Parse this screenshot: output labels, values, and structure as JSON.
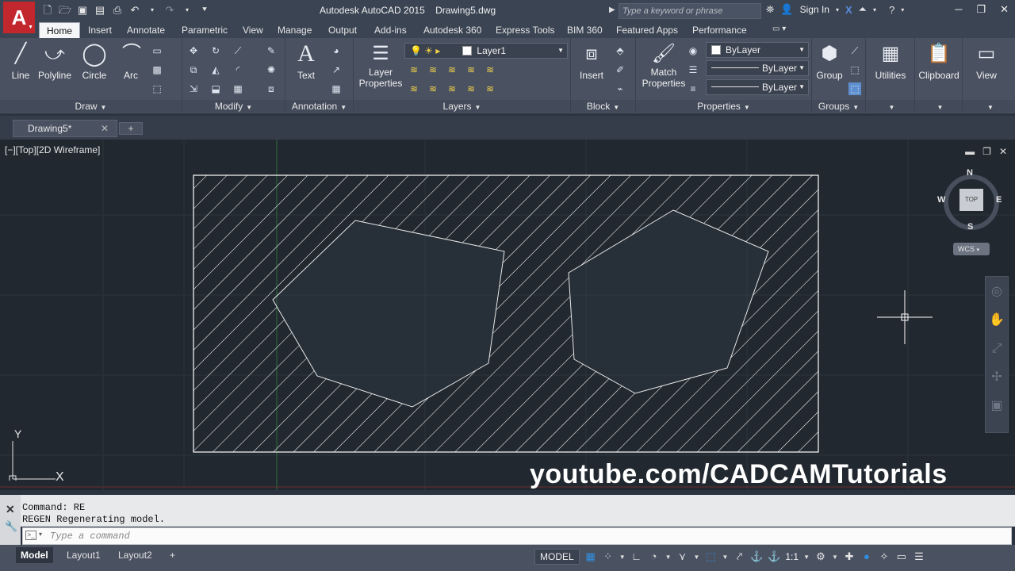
{
  "window": {
    "app_title": "Autodesk AutoCAD 2015",
    "doc_title": "Drawing5.dwg",
    "search_placeholder": "Type a keyword or phrase",
    "signin": "Sign In"
  },
  "ribbon_tabs": [
    "Home",
    "Insert",
    "Annotate",
    "Parametric",
    "View",
    "Manage",
    "Output",
    "Add-ins",
    "Autodesk 360",
    "Express Tools",
    "BIM 360",
    "Featured Apps",
    "Performance"
  ],
  "draw_panel": {
    "title": "Draw",
    "line": "Line",
    "polyline": "Polyline",
    "circle": "Circle",
    "arc": "Arc"
  },
  "modify_panel": {
    "title": "Modify"
  },
  "annotation_panel": {
    "title": "Annotation",
    "text": "Text"
  },
  "layers_panel": {
    "title": "Layers",
    "layer_properties_line1": "Layer",
    "layer_properties_line2": "Properties",
    "current_layer": "Layer1"
  },
  "block_panel": {
    "title": "Block",
    "insert": "Insert"
  },
  "properties_panel": {
    "title": "Properties",
    "match_line1": "Match",
    "match_line2": "Properties",
    "color": "ByLayer",
    "linetype": "ByLayer",
    "lineweight": "ByLayer"
  },
  "groups_panel": {
    "title": "Groups",
    "group": "Group"
  },
  "utilities": "Utilities",
  "clipboard": "Clipboard",
  "view": "View",
  "doc_tab": {
    "label": "Drawing5*",
    "close": "✕",
    "new": "+"
  },
  "viewport": {
    "label": "[−][Top][2D Wireframe]",
    "compass": {
      "n": "N",
      "s": "S",
      "e": "E",
      "w": "W",
      "top": "TOP"
    },
    "wcs": "WCS",
    "ucs": {
      "x": "X",
      "y": "Y"
    }
  },
  "watermark": "youtube.com/CADCAMTutorials",
  "command": {
    "line1": "Command: RE",
    "line2": "REGEN Regenerating model.",
    "placeholder": "Type a command"
  },
  "layout_tabs": [
    "Model",
    "Layout1",
    "Layout2"
  ],
  "status": {
    "model": "MODEL",
    "scale": "1:1"
  },
  "colors": {
    "accent_red": "#c1272d",
    "drawing_bg": "#212830",
    "ribbon_bg": "#4a5262",
    "status_blue": "#2f8fe0"
  }
}
